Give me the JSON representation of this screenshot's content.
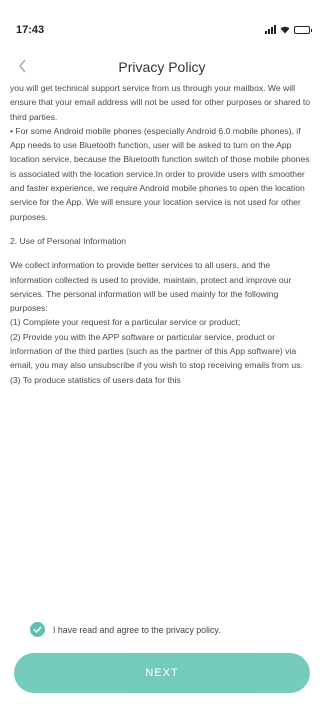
{
  "status_bar": {
    "time": "17:43",
    "icons": [
      "signal-icon",
      "wifi-icon",
      "battery-icon"
    ]
  },
  "nav": {
    "back_icon": "chevron-left-icon",
    "title": "Privacy Policy"
  },
  "content": {
    "paragraphs": [
      "you will get technical support service from us through your mailbox. We will ensure that your email address will not be used for other purposes or shared to third parties.",
      "• For some Android mobile phones (especially Android 6.0 mobile phones), if App needs to use Bluetooth function, user will be asked to turn on the App location service, because the Bluetooth function switch of those mobile phones is associated with the location service.In order to provide users with smoother and faster experience, we require Android mobile phones to open the location service for the App. We will ensure your location service is not used for other purposes.",
      "2. Use of Personal Information",
      "We collect information to provide better services to all users, and the information collected is used to provide, maintain, protect and improve our services. The personal information will be used mainly for the following purposes:",
      "(1) Complete your request for a particular service or product;",
      "(2) Provide you with the APP software or particular service, product or information of the third parties (such as the partner of this App software) via email, you may also unsubscribe if you wish to stop receiving emails from us.",
      "(3) To produce statistics of users data for this"
    ]
  },
  "agreement": {
    "checked": true,
    "label": "I have read and agree to the privacy policy."
  },
  "next_button": {
    "label": "NEXT"
  },
  "colors": {
    "accent": "#66c6b6",
    "check": "#5fbfb2"
  }
}
